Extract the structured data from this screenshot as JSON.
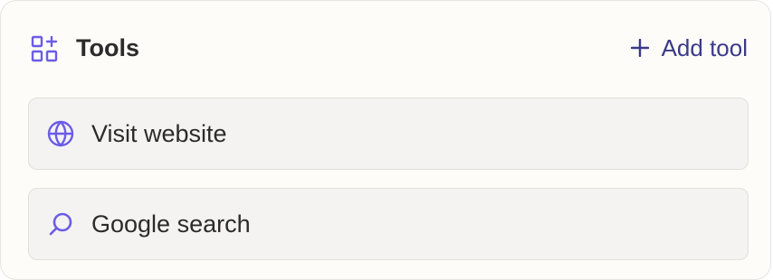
{
  "tools_panel": {
    "icon": "apps-add-icon",
    "title": "Tools",
    "add_button": {
      "icon": "plus-icon",
      "label": "Add tool"
    },
    "items": [
      {
        "label": "Visit website",
        "icon": "globe-icon"
      },
      {
        "label": "Google search",
        "icon": "search-icon"
      }
    ]
  },
  "colors": {
    "accent": "#6b5ce7",
    "link": "#3b3a8a",
    "card_bg": "#f4f3f2",
    "panel_bg": "#fdfcf9"
  }
}
